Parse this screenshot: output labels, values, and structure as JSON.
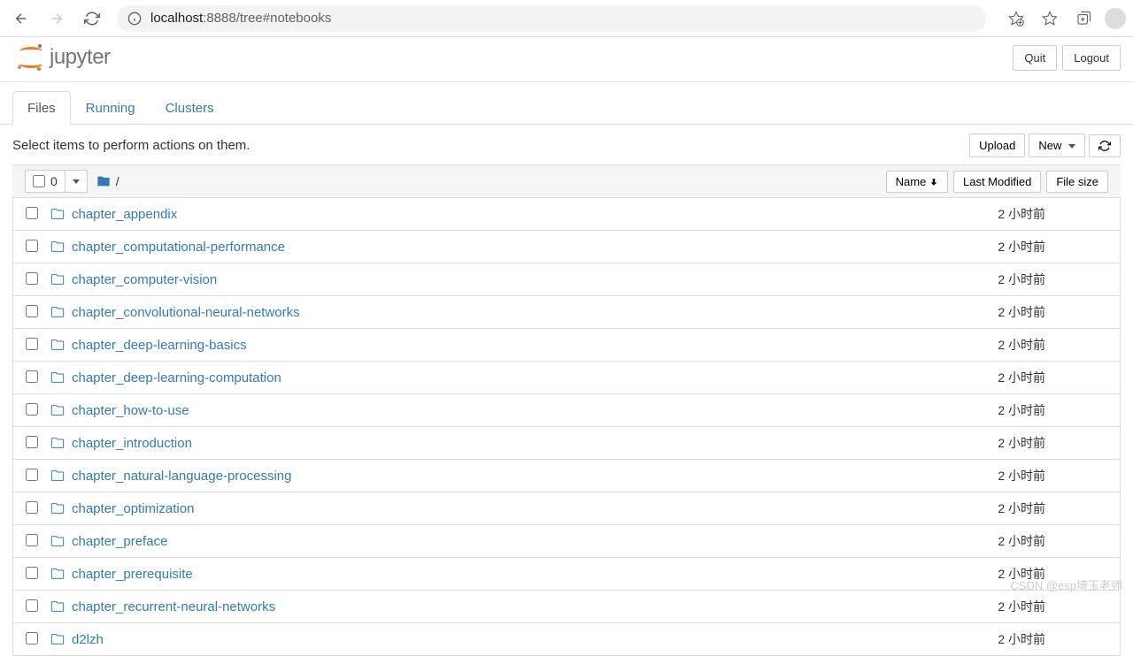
{
  "browser": {
    "url_host": "localhost",
    "url_port": ":8888",
    "url_path": "/tree#notebooks"
  },
  "header": {
    "logo_text": "jupyter",
    "quit": "Quit",
    "logout": "Logout"
  },
  "tabs": [
    {
      "label": "Files",
      "active": true
    },
    {
      "label": "Running",
      "active": false
    },
    {
      "label": "Clusters",
      "active": false
    }
  ],
  "toolbar": {
    "hint": "Select items to perform actions on them.",
    "upload": "Upload",
    "new": "New"
  },
  "file_header": {
    "selected_count": "0",
    "breadcrumb_root": "/",
    "sort_name": "Name",
    "sort_modified": "Last Modified",
    "sort_size": "File size"
  },
  "files": [
    {
      "name": "chapter_appendix",
      "modified": "2 小时前",
      "size": ""
    },
    {
      "name": "chapter_computational-performance",
      "modified": "2 小时前",
      "size": ""
    },
    {
      "name": "chapter_computer-vision",
      "modified": "2 小时前",
      "size": ""
    },
    {
      "name": "chapter_convolutional-neural-networks",
      "modified": "2 小时前",
      "size": ""
    },
    {
      "name": "chapter_deep-learning-basics",
      "modified": "2 小时前",
      "size": ""
    },
    {
      "name": "chapter_deep-learning-computation",
      "modified": "2 小时前",
      "size": ""
    },
    {
      "name": "chapter_how-to-use",
      "modified": "2 小时前",
      "size": ""
    },
    {
      "name": "chapter_introduction",
      "modified": "2 小时前",
      "size": ""
    },
    {
      "name": "chapter_natural-language-processing",
      "modified": "2 小时前",
      "size": ""
    },
    {
      "name": "chapter_optimization",
      "modified": "2 小时前",
      "size": ""
    },
    {
      "name": "chapter_preface",
      "modified": "2 小时前",
      "size": ""
    },
    {
      "name": "chapter_prerequisite",
      "modified": "2 小时前",
      "size": ""
    },
    {
      "name": "chapter_recurrent-neural-networks",
      "modified": "2 小时前",
      "size": ""
    },
    {
      "name": "d2lzh",
      "modified": "2 小时前",
      "size": ""
    }
  ],
  "watermark": "CSDN @esp埼玉老师"
}
